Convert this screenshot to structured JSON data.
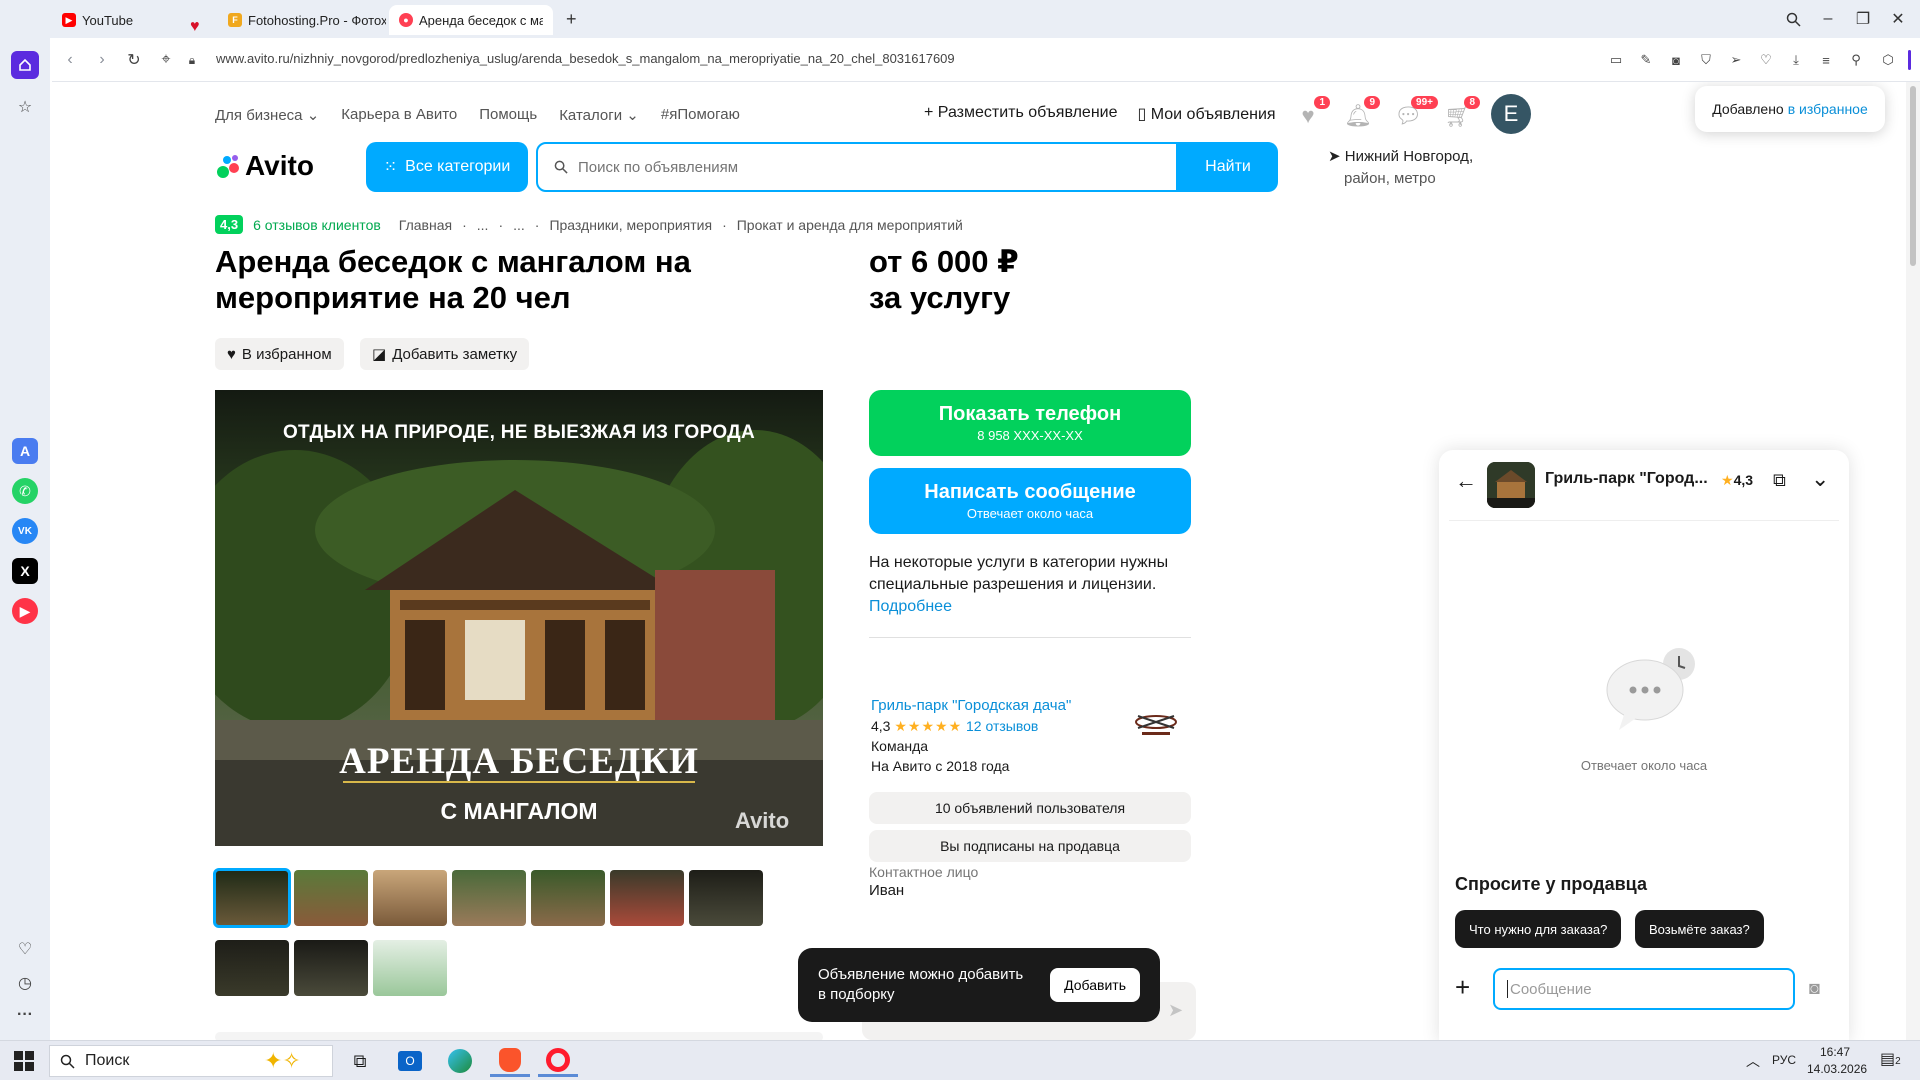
{
  "browser": {
    "tabs": [
      {
        "label": "YouTube"
      },
      {
        "label": "Fotohosting.Pro - Фотох..."
      },
      {
        "label": "Аренда беседок с манга..."
      }
    ],
    "new_tab_symbol": "+",
    "url": "www.avito.ru/nizhniy_novgorod/predlozheniya_uslug/arenda_besedok_s_mangalom_na_meropriyatie_na_20_chel_8031617609"
  },
  "header": {
    "top_links": [
      {
        "label": "Для бизнеса",
        "dropdown": true
      },
      {
        "label": "Карьера в Авито",
        "dropdown": false
      },
      {
        "label": "Помощь",
        "dropdown": false
      },
      {
        "label": "Каталоги",
        "dropdown": true
      },
      {
        "label": "#яПомогаю",
        "dropdown": false
      }
    ],
    "post_ad": "Разместить объявление",
    "my_ads": "Мои объявления",
    "badges": {
      "favorites": "1",
      "notifications": "9",
      "messages": "99+",
      "cart": "8"
    },
    "avatar_letter": "E",
    "logo_text": "Avito",
    "all_categories": "Все категории",
    "search_placeholder": "Поиск по объявлениям",
    "search_button": "Найти",
    "location_city": "Нижний Новгород,",
    "location_sub": "район, метро"
  },
  "favorite_toast": {
    "text": "Добавлено",
    "link": "в избранное"
  },
  "breadcrumbs": {
    "rating": "4,3",
    "reviews": "6 отзывов клиентов",
    "items": [
      "Главная",
      "...",
      "...",
      "Праздники, мероприятия",
      "Прокат и аренда для мероприятий"
    ],
    "separator": "·"
  },
  "listing": {
    "title": "Аренда беседок с мангалом на мероприятие на 20 чел",
    "price_line1": "от 6 000 ₽",
    "price_line2": "за услугу",
    "favorite_chip": "В избранном",
    "note_chip": "Добавить заметку",
    "photo_top_text": "ОТДЫХ НА ПРИРОДЕ, НЕ ВЫЕЗЖАЯ ИЗ ГОРОДА",
    "photo_big_text": "АРЕНДА БЕСЕДКИ",
    "photo_small_text": "С МАНГАЛОМ",
    "photo_watermark": "Avito",
    "thumbnail_count": 10,
    "selected_thumbnail": 0
  },
  "actions": {
    "phone_label": "Показать телефон",
    "phone_number": "8 958 XXX-XX-XX",
    "message_label": "Написать сообщение",
    "message_sub": "Отвечает около часа",
    "license_text": "На некоторые услуги в категории нужны специальные разрешения и лицензии.",
    "license_link": "Подробнее"
  },
  "seller": {
    "name": "Гриль-парк \"Городская дача\"",
    "rating": "4,3",
    "stars": "★★★★★",
    "reviews": "12 отзывов",
    "type": "Команда",
    "since": "На Авито с 2018 года",
    "listings_button": "10 объявлений пользователя",
    "subscribed_button": "Вы подписаны на продавца",
    "contact_label": "Контактное лицо",
    "contact_name": "Иван"
  },
  "collection_toast": {
    "text": "Объявление можно добавить в подборку",
    "button": "Добавить"
  },
  "chat": {
    "title": "Гриль-парк \"Город...",
    "rating": "4,3",
    "empty_text": "Отвечает около часа",
    "ask_title": "Спросите у продавца",
    "quick_questions": [
      "Что нужно для заказа?",
      "Возьмёте заказ?"
    ],
    "input_placeholder": "Сообщение"
  },
  "taskbar": {
    "search_label": "Поиск",
    "language": "РУС",
    "time": "16:47",
    "date": "14.03.2026",
    "notifications": "2"
  },
  "colors": {
    "avito_blue": "#00aaff",
    "avito_green": "#02d15c",
    "badge_red": "#ff4053",
    "link_blue": "#0a8fd8"
  }
}
